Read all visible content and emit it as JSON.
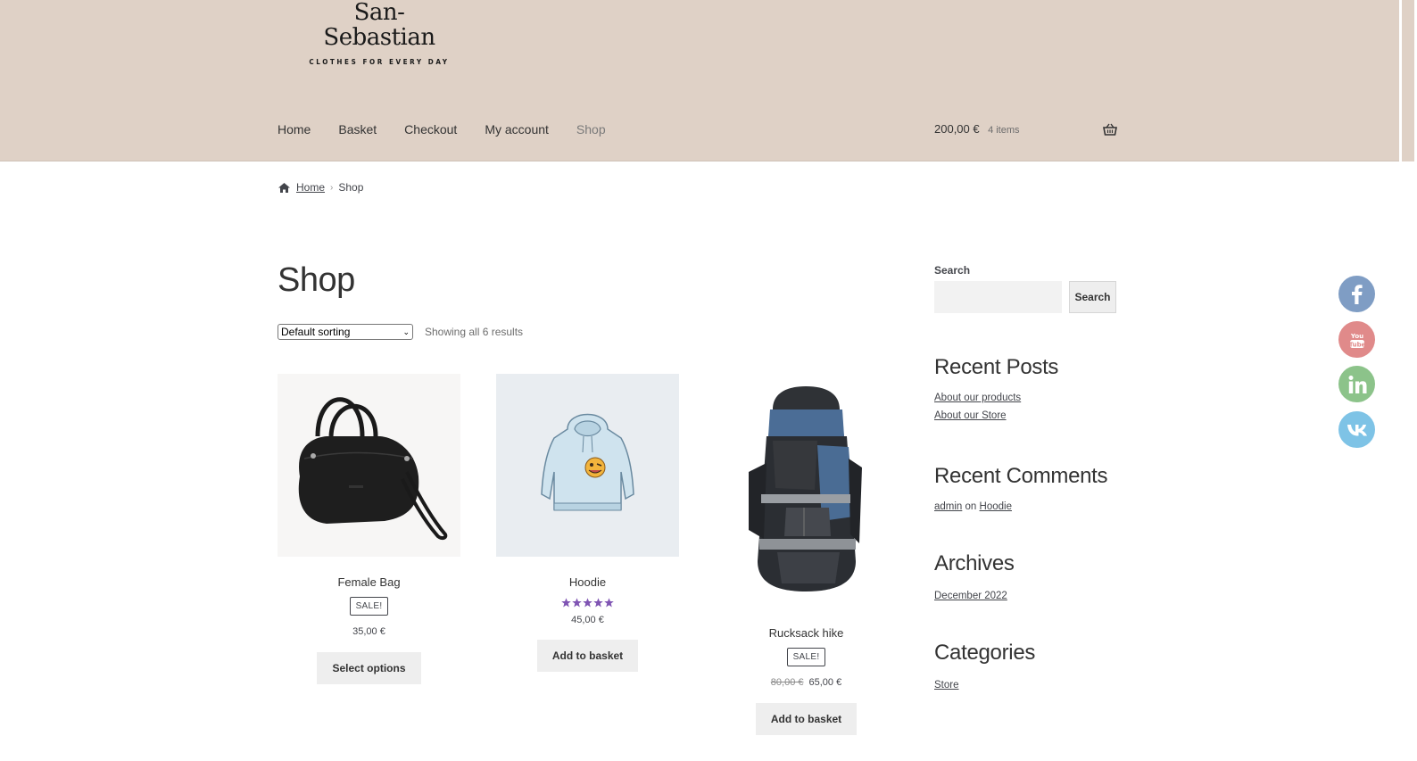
{
  "site": {
    "name": "San-Sebastian",
    "tagline": "CLOTHES FOR EVERY DAY"
  },
  "nav": {
    "items": [
      {
        "label": "Home"
      },
      {
        "label": "Basket"
      },
      {
        "label": "Checkout"
      },
      {
        "label": "My account"
      },
      {
        "label": "Shop",
        "current": true
      }
    ]
  },
  "cart": {
    "amount": "200,00 €",
    "count": "4 items",
    "icon": "basket-icon"
  },
  "breadcrumb": {
    "home": "Home",
    "current": "Shop",
    "icon": "home-icon"
  },
  "main": {
    "title": "Shop",
    "sorting": {
      "selected": "Default sorting"
    },
    "results_count": "Showing all 6 results",
    "products": [
      {
        "name": "Female Bag",
        "badge": "SALE!",
        "price": "35,00 €",
        "button": "Select options",
        "image": "black-handbag"
      },
      {
        "name": "Hoodie",
        "rating": 5,
        "price": "45,00 €",
        "button": "Add to basket",
        "image": "light-blue-hoodie"
      },
      {
        "name": "Rucksack hike",
        "badge": "SALE!",
        "old_price": "80,00 €",
        "price": "65,00 €",
        "button": "Add to basket",
        "image": "hiking-backpack"
      }
    ]
  },
  "sidebar": {
    "search": {
      "label": "Search",
      "button": "Search",
      "value": ""
    },
    "recent_posts": {
      "title": "Recent Posts",
      "items": [
        "About our products",
        "About our Store"
      ]
    },
    "recent_comments": {
      "title": "Recent Comments",
      "author": "admin",
      "on": "on",
      "post": "Hoodie"
    },
    "archives": {
      "title": "Archives",
      "items": [
        "December 2022"
      ]
    },
    "categories": {
      "title": "Categories",
      "items": [
        "Store"
      ]
    }
  },
  "social": [
    {
      "icon": "facebook-icon",
      "color": "#7f9dc4"
    },
    {
      "icon": "youtube-icon",
      "color": "#e08a8a"
    },
    {
      "icon": "linkedin-icon",
      "color": "#8cc38a"
    },
    {
      "icon": "vk-icon",
      "color": "#7ec3e6"
    }
  ],
  "colors": {
    "header_bg": "#dfd1c6",
    "star": "#7f54b3",
    "button_bg": "#eeeeee"
  }
}
